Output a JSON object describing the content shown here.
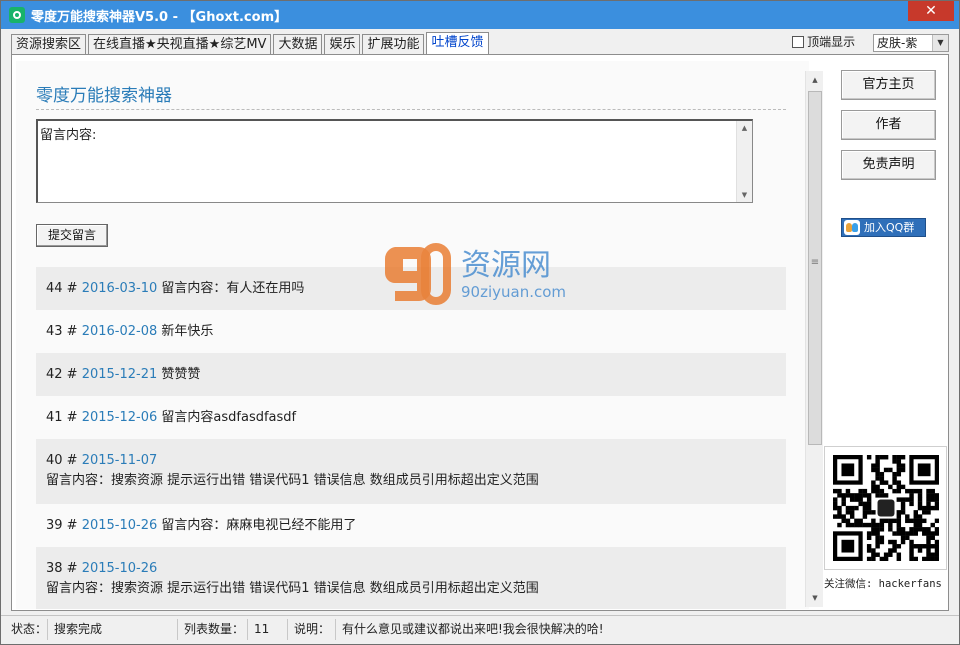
{
  "window": {
    "title": "零度万能搜索神器V5.0 - 【Ghoxt.com】",
    "close_label": "✕"
  },
  "tabs": [
    {
      "label": "资源搜索区"
    },
    {
      "label": "在线直播★央视直播★综艺MV"
    },
    {
      "label": "大数据"
    },
    {
      "label": "娱乐"
    },
    {
      "label": "扩展功能"
    },
    {
      "label": "吐槽反馈",
      "active": true
    }
  ],
  "topright": {
    "checkbox_label": "顶端显示",
    "checkbox_checked": false,
    "skin_value": "皮肤-紫"
  },
  "main": {
    "heading": "零度万能搜索神器",
    "textarea_value": "留言内容:",
    "submit_label": "提交留言",
    "comments": [
      {
        "num": "44 #",
        "date": "2016-03-10",
        "text": "留言内容：有人还在用吗",
        "body": ""
      },
      {
        "num": "43 #",
        "date": "2016-02-08",
        "text": "新年快乐",
        "body": ""
      },
      {
        "num": "42 #",
        "date": "2015-12-21",
        "text": "赞赞赞",
        "body": ""
      },
      {
        "num": "41 #",
        "date": "2015-12-06",
        "text": "留言内容asdfasdfasdf",
        "body": ""
      },
      {
        "num": "40 #",
        "date": "2015-11-07",
        "text": "",
        "body": "留言内容：搜索资源  提示运行出错  错误代码1 错误信息  数组成员引用标超出定义范围"
      },
      {
        "num": "39 #",
        "date": "2015-10-26",
        "text": "留言内容：麻麻电视已经不能用了",
        "body": ""
      },
      {
        "num": "38 #",
        "date": "2015-10-26",
        "text": "",
        "body": "留言内容：搜索资源  提示运行出错  错误代码1 错误信息  数组成员引用标超出定义范围"
      }
    ]
  },
  "sidebar": {
    "buttons": [
      {
        "label": "官方主页"
      },
      {
        "label": "作者"
      },
      {
        "label": "免责声明"
      }
    ],
    "qq_label": "加入QQ群",
    "follow_text": "关注微信: hackerfans"
  },
  "watermark": {
    "brand": "资源网",
    "domain": "90ziyuan.com"
  },
  "statusbar": {
    "status_label": "状态：",
    "status_value": "搜索完成",
    "count_label": "列表数量：",
    "count_value": "11",
    "note_label": "说明：",
    "note_value": "有什么意见或建议都说出来吧!我会很快解决的哈!"
  },
  "colors": {
    "titlebar": "#3b8fde",
    "link": "#2a7cb8",
    "close": "#c7392b"
  }
}
